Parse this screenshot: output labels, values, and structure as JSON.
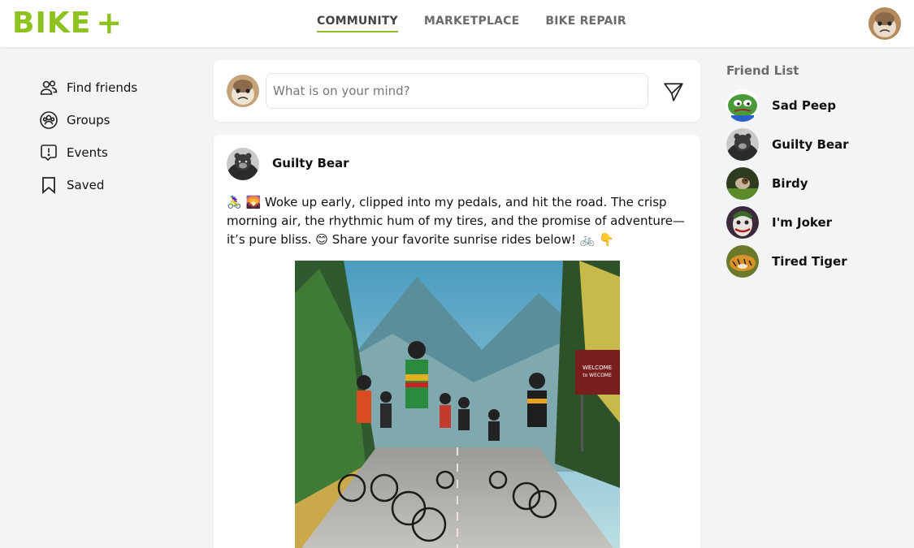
{
  "brand": {
    "name": "BIKE",
    "plus": "+",
    "accent": "#8dc21f"
  },
  "nav": [
    {
      "label": "COMMUNITY",
      "active": true
    },
    {
      "label": "MARKETPLACE",
      "active": false
    },
    {
      "label": "BIKE REPAIR",
      "active": false
    }
  ],
  "sidebar": {
    "items": [
      {
        "label": "Find friends",
        "icon": "people-icon"
      },
      {
        "label": "Groups",
        "icon": "groups-icon"
      },
      {
        "label": "Events",
        "icon": "alert-message-icon"
      },
      {
        "label": "Saved",
        "icon": "bookmark-icon"
      }
    ]
  },
  "composer": {
    "placeholder": "What is on your mind?",
    "send_icon": "send-icon"
  },
  "post": {
    "author": "Guilty Bear",
    "text": "🚴‍♀️ 🌄 Woke up early, clipped into my pedals, and hit the road. The crisp morning air, the rhythmic hum of my tires, and the promise of adventure—it’s pure bliss. 😊 Share your favorite sunrise rides below! 🚲 👇",
    "image_sign": [
      "WELCOME",
      "to WECOME"
    ]
  },
  "friends": {
    "title": "Friend List",
    "list": [
      {
        "name": "Sad Peep"
      },
      {
        "name": "Guilty Bear"
      },
      {
        "name": "Birdy"
      },
      {
        "name": "I'm Joker"
      },
      {
        "name": "Tired Tiger"
      }
    ]
  }
}
